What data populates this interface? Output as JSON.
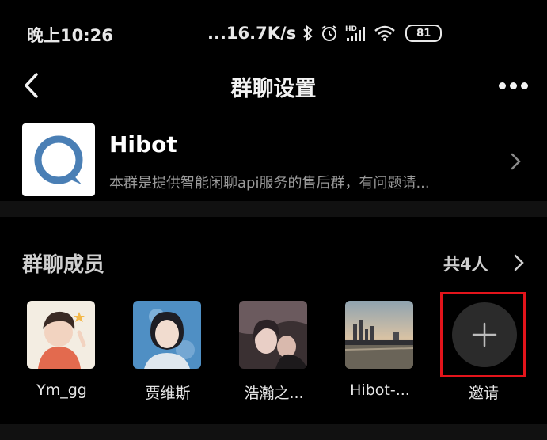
{
  "status_bar": {
    "time": "晚上10:26",
    "net_speed": "...16.7K/s",
    "battery_level": "81",
    "icons": [
      "bluetooth-icon",
      "alarm-icon",
      "hd-signal-icon",
      "wifi-icon",
      "battery-icon"
    ]
  },
  "nav": {
    "title": "群聊设置",
    "back_icon": "chevron-left-icon",
    "more_icon": "more-dots-icon"
  },
  "group": {
    "name": "Hibot",
    "description": "本群是提供智能闲聊api服务的售后群，有问题请...",
    "avatar_color": "#4a7fb5"
  },
  "members": {
    "title": "群聊成员",
    "count_label": "共4人",
    "list": [
      {
        "name": "Ym_gg"
      },
      {
        "name": "贾维斯"
      },
      {
        "name": "浩瀚之..."
      },
      {
        "name": "Hibot-..."
      }
    ],
    "invite_label": "邀请",
    "highlight_color": "#e3141b"
  }
}
